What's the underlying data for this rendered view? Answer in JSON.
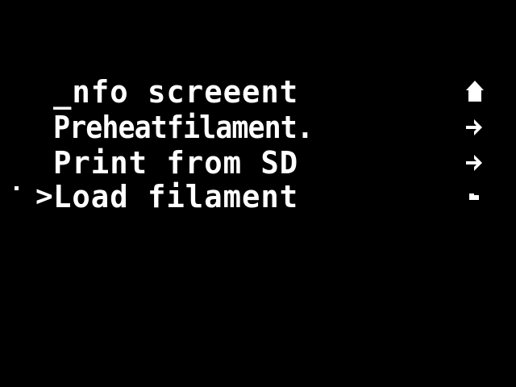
{
  "menu": {
    "items": [
      {
        "label": "_nfo screeent",
        "indicator": "home-icon"
      },
      {
        "label": "Preheatfilament.",
        "indicator": "chevron-right-icon"
      },
      {
        "label": "Print from SD",
        "indicator": "chevron-right-icon"
      },
      {
        "label": "Load filament",
        "indicator": "chevron-right-icon"
      }
    ],
    "selected_index": 3,
    "cursor": ">"
  },
  "colors": {
    "background": "#000000",
    "foreground": "#ffffff"
  }
}
